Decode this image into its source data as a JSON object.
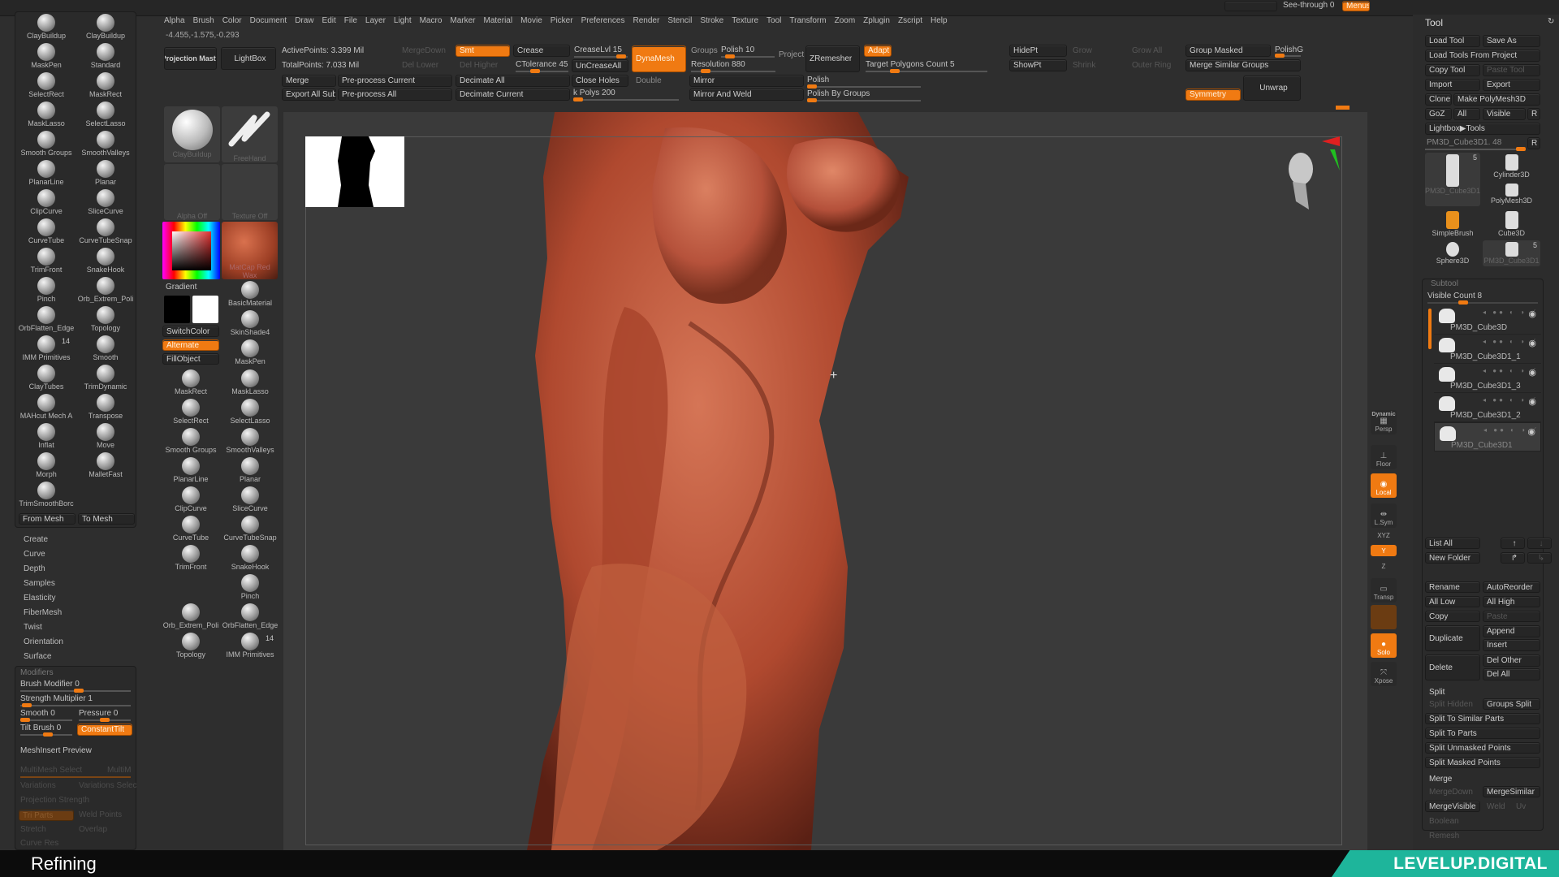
{
  "top": {
    "see_through": "See-through  0",
    "menus": "Menus"
  },
  "menu": [
    "Alpha",
    "Brush",
    "Color",
    "Document",
    "Draw",
    "Edit",
    "File",
    "Layer",
    "Light",
    "Macro",
    "Marker",
    "Material",
    "Movie",
    "Picker",
    "Preferences",
    "Render",
    "Stencil",
    "Stroke",
    "Texture",
    "Tool",
    "Transform",
    "Zoom",
    "Zplugin",
    "Zscript",
    "Help"
  ],
  "coords": "-4.455,-1.575,-0.293",
  "toolbar": {
    "projection_master": "Projection Master",
    "lightbox": "LightBox",
    "active_points": "ActivePoints: 3.399 Mil",
    "total_points": "TotalPoints: 7.033 Mil",
    "merge_down": "MergeDown",
    "del_lower": "Del Lower",
    "del_higher": "Del Higher",
    "smt": "Smt",
    "crease": "Crease",
    "crease_lvl": "CreaseLvl 15",
    "ctolerance": "CTolerance 45",
    "uncrease_all": "UnCreaseAll",
    "dynamesh": "DynaMesh",
    "groups": "Groups",
    "polish": "Polish 10",
    "resolution": "Resolution 880",
    "project": "Project",
    "zremesher": "ZRemesher",
    "adapt": "Adapt",
    "target_polys": "Target Polygons Count 5",
    "merge": "Merge",
    "preprocess_current": "Pre-process Current",
    "decimate_all": "Decimate All",
    "close_holes": "Close Holes",
    "double": "Double",
    "mirror": "Mirror",
    "polish2": "Polish",
    "export_all": "Export All SubTo",
    "preprocess_all": "Pre-process All",
    "decimate_current": "Decimate Current",
    "k_polys": "k Polys 200",
    "mirror_weld": "Mirror And Weld",
    "polish_groups": "Polish By Groups",
    "hidept": "HidePt",
    "showpt": "ShowPt",
    "grow": "Grow",
    "grow_all": "Grow All",
    "shrink": "Shrink",
    "outer_ring": "Outer Ring",
    "group_masked": "Group Masked",
    "merge_similar_groups": "Merge Similar Groups",
    "polishg": "PolishG",
    "symmetry": "Symmetry",
    "unwrap": "Unwrap"
  },
  "brushes_left": [
    "ClayBuildup",
    "ClayBuildup",
    "MaskPen",
    "Standard",
    "SelectRect",
    "MaskRect",
    "MaskLasso",
    "SelectLasso",
    "Smooth Groups",
    "SmoothValleys",
    "PlanarLine",
    "Planar",
    "ClipCurve",
    "SliceCurve",
    "CurveTube",
    "CurveTubeSnap",
    "TrimFront",
    "SnakeHook",
    "Pinch",
    "Orb_Extrem_Poli",
    "OrbFlatten_Edge",
    "Topology",
    "IMM Primitives",
    "Smooth",
    "ClayTubes",
    "TrimDynamic",
    "MAHcut Mech A",
    "Transpose",
    "Inflat",
    "Move",
    "Morph",
    "MalletFast",
    "TrimSmoothBorc"
  ],
  "imm_count": "14",
  "from_mesh": "From Mesh",
  "to_mesh": "To Mesh",
  "brush_menu": [
    "Create",
    "Curve",
    "Depth",
    "Samples",
    "Elasticity",
    "FiberMesh",
    "Twist",
    "Orientation",
    "Surface"
  ],
  "modifiers": {
    "title": "Modifiers",
    "brush_modifier": "Brush Modifier 0",
    "strength_multiplier": "Strength Multiplier 1",
    "smooth": "Smooth 0",
    "pressure": "Pressure 0",
    "tilt_brush": "Tilt Brush 0",
    "constant_tilt": "ConstantTilt",
    "meshinsert_preview": "MeshInsert Preview",
    "multimesh_select": "MultiMesh Select",
    "multim": "MultiM",
    "variations": "Variations",
    "variations_select": "Variations Selec",
    "projection_strength": "Projection Strength",
    "tri_parts": "Tri Parts",
    "weld_points": "Weld Points",
    "stretch": "Stretch",
    "overlap": "Overlap",
    "curve_res": "Curve Res"
  },
  "palette": {
    "current_brush": "ClayBuildup",
    "stroke": "FreeHand",
    "alpha": "Alpha Off",
    "texture": "Texture Off",
    "material": "MatCap Red Wax",
    "gradient": "Gradient",
    "switch_color": "SwitchColor",
    "alternate": "Alternate",
    "fill_object": "FillObject",
    "basic_material": "BasicMaterial",
    "skinshade": "SkinShade4",
    "maskpen": "MaskPen"
  },
  "brushes_mid": [
    "MaskRect",
    "MaskLasso",
    "SelectRect",
    "SelectLasso",
    "Smooth Groups",
    "SmoothValleys",
    "PlanarLine",
    "Planar",
    "ClipCurve",
    "SliceCurve",
    "CurveTube",
    "CurveTubeSnap",
    "TrimFront",
    "SnakeHook",
    "",
    "Pinch",
    "Orb_Extrem_Poli",
    "OrbFlatten_Edge",
    "Topology",
    "IMM Primitives"
  ],
  "shelf": [
    "Persp",
    "Floor",
    "Local",
    "L.Sym",
    "XYZ",
    "Y",
    "Z",
    "Transp",
    "",
    "Solo",
    "Xpose"
  ],
  "shelf_dynamic": "Dynamic",
  "tool": {
    "title": "Tool",
    "load_tool": "Load Tool",
    "save_as": "Save As",
    "load_from_project": "Load Tools From Project",
    "copy_tool": "Copy Tool",
    "paste_tool": "Paste Tool",
    "import": "Import",
    "export": "Export",
    "clone": "Clone",
    "make_polymesh": "Make PolyMesh3D",
    "goz": "GoZ",
    "all": "All",
    "visible": "Visible",
    "r": "R",
    "lightbox_tools": "Lightbox▶Tools",
    "current_tool": "PM3D_Cube3D1. 48",
    "thumbs": [
      "PM3D_Cube3D1",
      "Cylinder3D",
      "PolyMesh3D",
      "SimpleBrush",
      "Cube3D",
      "Sphere3D",
      "PM3D_Cube3D1"
    ],
    "thumb_count": "5"
  },
  "subtool": {
    "title": "Subtool",
    "visible_count": "Visible Count 8",
    "items": [
      "PM3D_Cube3D",
      "PM3D_Cube3D1_1",
      "PM3D_Cube3D1_3",
      "PM3D_Cube3D1_2",
      "PM3D_Cube3D1"
    ],
    "selected": 4,
    "list_all": "List All",
    "new_folder": "New Folder",
    "rename": "Rename",
    "auto_reorder": "AutoReorder",
    "all_low": "All Low",
    "all_high": "All High",
    "copy": "Copy",
    "paste": "Paste",
    "duplicate": "Duplicate",
    "append": "Append",
    "insert": "Insert",
    "delete": "Delete",
    "del_other": "Del Other",
    "del_all": "Del All",
    "split": "Split",
    "split_hidden": "Split Hidden",
    "groups_split": "Groups Split",
    "split_similar": "Split To Similar Parts",
    "split_parts": "Split To Parts",
    "split_unmasked": "Split Unmasked Points",
    "split_masked": "Split Masked Points",
    "merge": "Merge",
    "merge_down": "MergeDown",
    "merge_similar": "MergeSimilar",
    "merge_visible": "MergeVisible",
    "weld": "Weld",
    "uv": "Uv",
    "boolean": "Boolean",
    "remesh": "Remesh"
  },
  "caption": "Refining",
  "brand": "LEVELUP.DIGITAL",
  "colors": {
    "accent": "#f07a12",
    "model": "#b5543a",
    "brand": "#1eb59b"
  }
}
